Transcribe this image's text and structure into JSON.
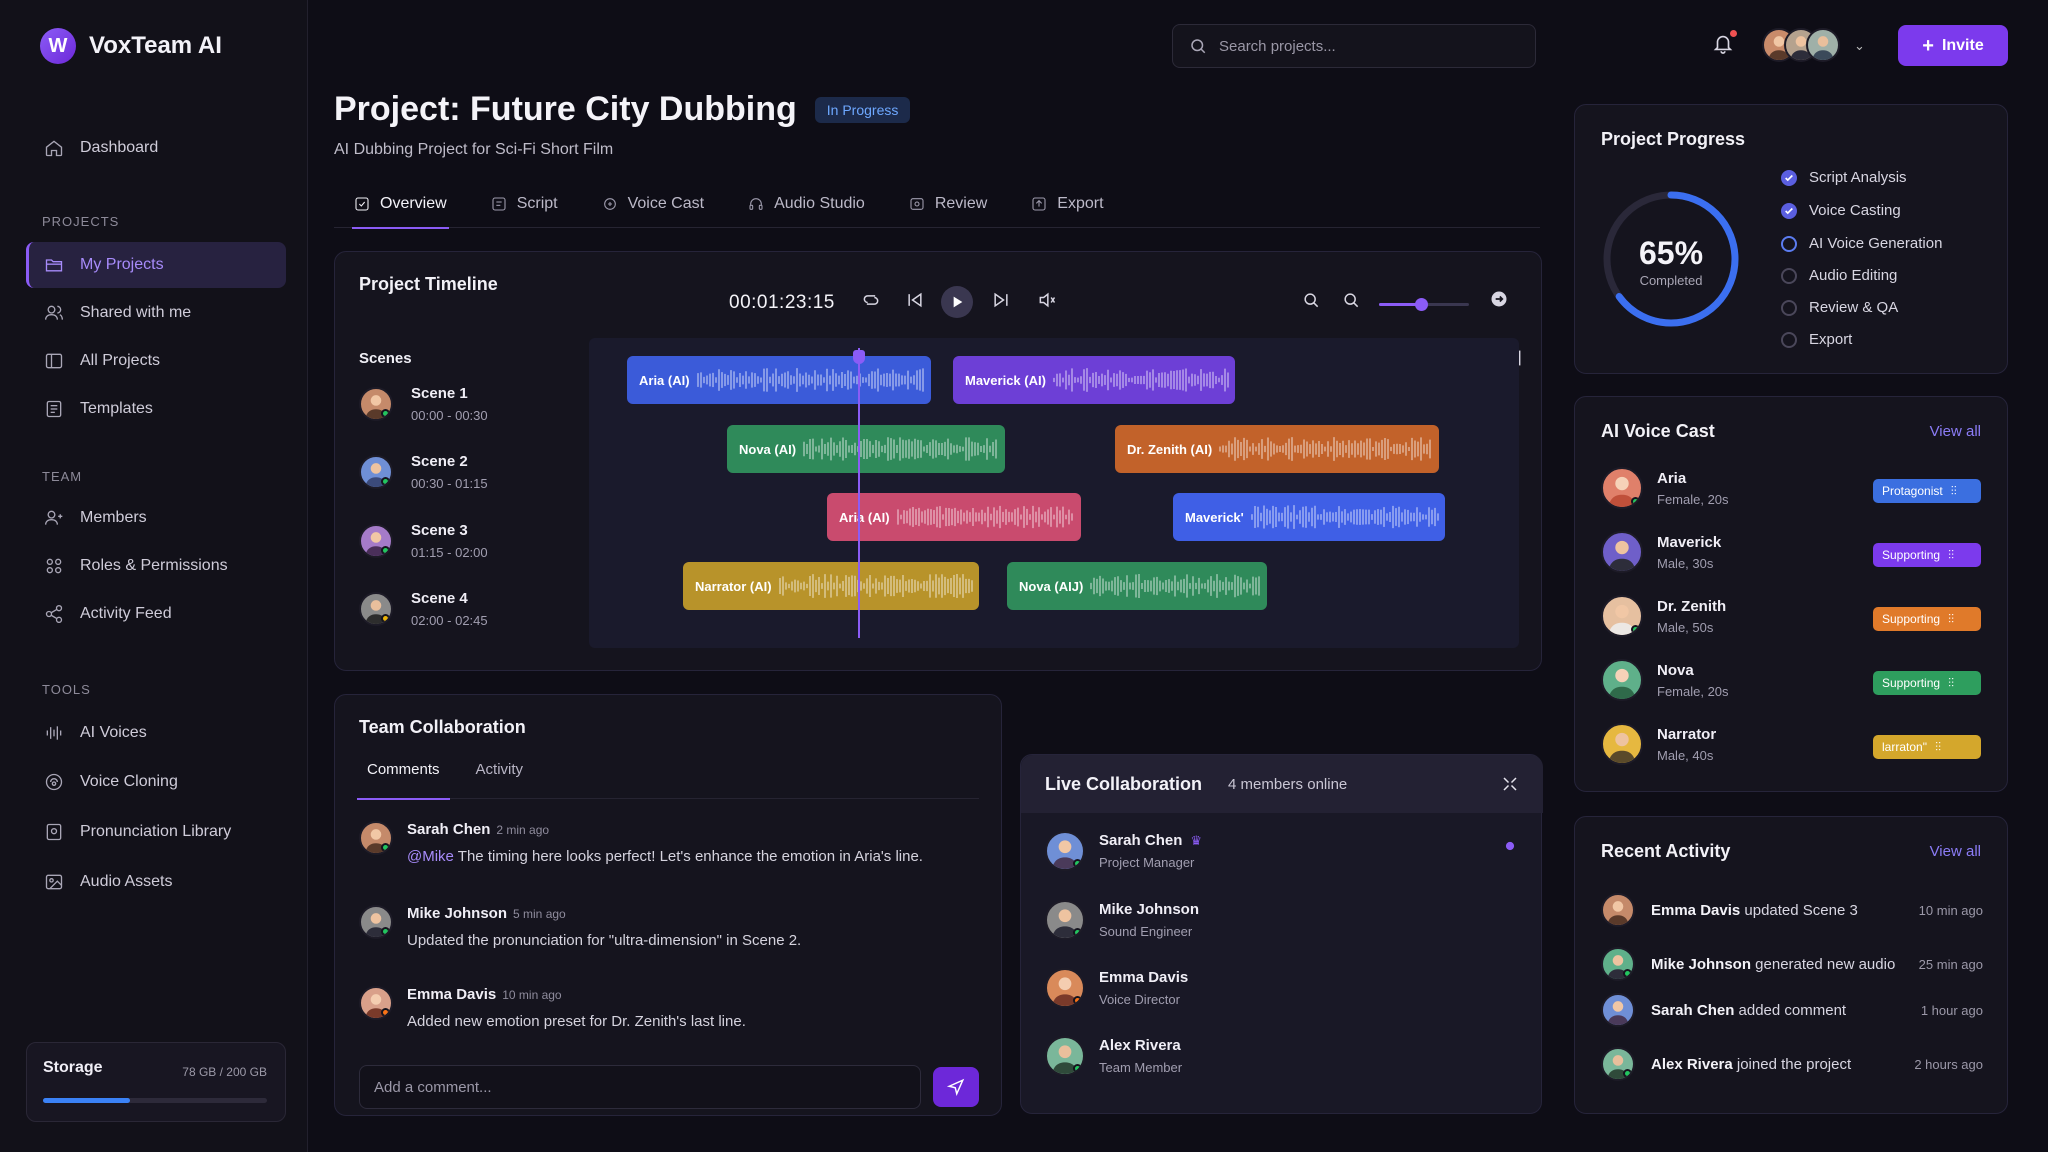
{
  "app": {
    "logo_letter": "W",
    "name": "VoxTeam AI"
  },
  "nav": {
    "dashboard": "Dashboard",
    "projects_label": "PROJECTS",
    "my_projects": "My Projects",
    "shared": "Shared with me",
    "all_projects": "All Projects",
    "templates": "Templates",
    "team_label": "TEAM",
    "members": "Members",
    "roles": "Roles & Permissions",
    "activity_feed": "Activity Feed",
    "tools_label": "TOOLS",
    "ai_voices": "AI Voices",
    "voice_cloning": "Voice Cloning",
    "pronunciation": "Pronunciation Library",
    "audio_assets": "Audio Assets"
  },
  "storage": {
    "title": "Storage",
    "value": "78 GB / 200 GB",
    "used_fraction": 0.39
  },
  "topbar": {
    "search_placeholder": "Search projects...",
    "invite": "Invite"
  },
  "project": {
    "title": "Project: Future City Dubbing",
    "status": "In Progress",
    "subtitle": "AI Dubbing Project for Sci-Fi Short Film"
  },
  "tabs": [
    "Overview",
    "Script",
    "Voice Cast",
    "Audio Studio",
    "Review",
    "Export"
  ],
  "timeline": {
    "title": "Project Timeline",
    "time": "00:01:23:15",
    "scenes_label": "Scenes",
    "scenes": [
      {
        "name": "Scene 1",
        "time": "00:00 - 00:30"
      },
      {
        "name": "Scene 2",
        "time": "00:30 - 01:15"
      },
      {
        "name": "Scene 3",
        "time": "01:15 - 02:00"
      },
      {
        "name": "Scene 4",
        "time": "02:00 - 02:45"
      }
    ],
    "clips": [
      {
        "label": "Aria (AI)",
        "color": "#3b5bd9"
      },
      {
        "label": "Maverick (AI)",
        "color": "#6d3fd6"
      },
      {
        "label": "Nova (AI)",
        "color": "#2f8a5a"
      },
      {
        "label": "Dr. Zenith (AI)",
        "color": "#c2622a"
      },
      {
        "label": "Aria (AI)",
        "color": "#c94b6e"
      },
      {
        "label": "Maverick'",
        "color": "#3f5fe6"
      },
      {
        "label": "Narrator (AI)",
        "color": "#b8932a"
      },
      {
        "label": "Nova (AIJ)",
        "color": "#2f8a5a"
      }
    ]
  },
  "collab": {
    "title": "Team Collaboration",
    "tabs": [
      "Comments",
      "Activity"
    ],
    "comments": [
      {
        "name": "Sarah Chen",
        "time": "2 min ago",
        "mention": "@Mike",
        "text": " The timing here looks perfect! Let's enhance the emotion in Aria's line."
      },
      {
        "name": "Mike Johnson",
        "time": "5 min ago",
        "text": "Updated the pronunciation for \"ultra-dimension\" in Scene 2."
      },
      {
        "name": "Emma Davis",
        "time": "10 min ago",
        "text": "Added new emotion preset for Dr. Zenith's last line."
      }
    ],
    "input_placeholder": "Add a comment..."
  },
  "live": {
    "title": "Live Collaboration",
    "online": "4 members online",
    "members": [
      {
        "name": "Sarah Chen",
        "role": "Project Manager"
      },
      {
        "name": "Mike Johnson",
        "role": "Sound Engineer"
      },
      {
        "name": "Emma Davis",
        "role": "Voice Director"
      },
      {
        "name": "Alex Rivera",
        "role": "Team Member"
      }
    ]
  },
  "progress": {
    "title": "Project Progress",
    "percent": "65%",
    "percent_value": 0.65,
    "label": "Completed",
    "steps": [
      {
        "name": "Script Analysis",
        "state": "done"
      },
      {
        "name": "Voice Casting",
        "state": "done"
      },
      {
        "name": "AI Voice Generation",
        "state": "current"
      },
      {
        "name": "Audio Editing",
        "state": "todo"
      },
      {
        "name": "Review & QA",
        "state": "todo"
      },
      {
        "name": "Export",
        "state": "todo"
      }
    ]
  },
  "cast": {
    "title": "AI Voice Cast",
    "view_all": "View all",
    "items": [
      {
        "name": "Aria",
        "meta": "Female, 20s",
        "role": "Protagonist",
        "color": "#3b6fe0"
      },
      {
        "name": "Maverick",
        "meta": "Male, 30s",
        "role": "Supporting",
        "color": "#7c3aed"
      },
      {
        "name": "Dr. Zenith",
        "meta": "Male, 50s",
        "role": "Supporting",
        "color": "#e07a2a"
      },
      {
        "name": "Nova",
        "meta": "Female, 20s",
        "role": "Supporting",
        "color": "#2e9e5e"
      },
      {
        "name": "Narrator",
        "meta": "Male, 40s",
        "role": "larraton\"",
        "color": "#d4a72c"
      }
    ]
  },
  "activity": {
    "title": "Recent Activity",
    "view_all": "View all",
    "items": [
      {
        "name": "Emma Davis",
        "action": " updated Scene 3",
        "time": "10 min ago"
      },
      {
        "name": "Mike Johnson",
        "action": " generated new audio",
        "time": "25 min ago"
      },
      {
        "name": "Sarah Chen",
        "action": " added comment",
        "time": "1 hour ago"
      },
      {
        "name": "Alex Rivera",
        "action": " joined the project",
        "time": "2 hours ago"
      }
    ]
  }
}
